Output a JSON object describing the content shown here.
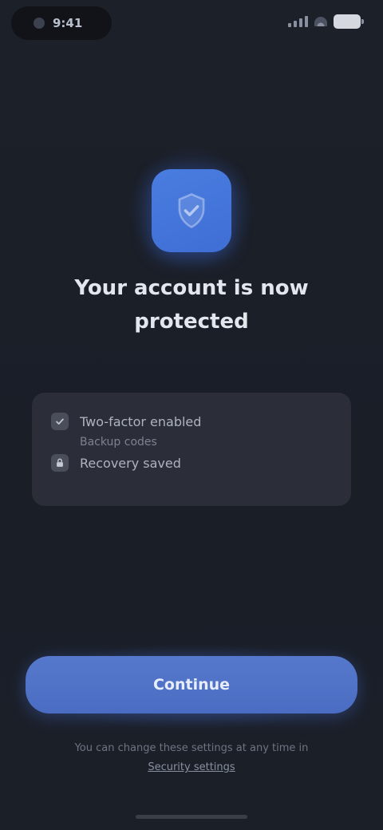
{
  "status_bar": {
    "time": "9:41",
    "battery_icon": "battery-icon",
    "wifi_icon": "wifi-icon",
    "signal_icon": "signal-icon"
  },
  "app": {
    "icon": "shield-check-icon",
    "accent_color": "#4a7de0",
    "title": "Your account is now protected"
  },
  "info_card": {
    "rows": [
      {
        "icon": "check-icon",
        "label": "Two-factor enabled"
      },
      {
        "icon": "lock-icon",
        "label": "Recovery saved"
      }
    ],
    "sub_label": "Backup codes"
  },
  "primary_button": {
    "label": "Continue"
  },
  "footer": {
    "text": "You can change these settings at any time in",
    "link_label": "Security settings"
  }
}
